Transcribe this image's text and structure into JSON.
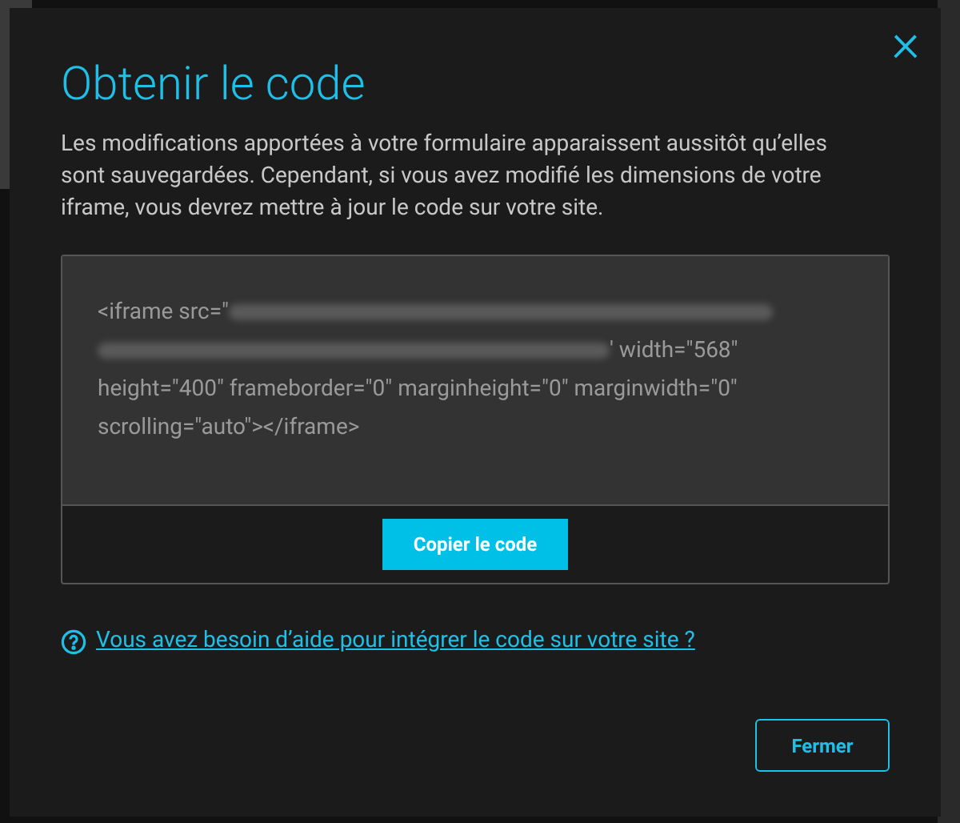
{
  "dialog": {
    "title": "Obtenir le code",
    "close": "×",
    "description": "Les modifications apportées à votre formulaire apparaissent aussitôt qu’elles sont sauvegardées. Cependant, si vous avez modifié les dimensions de votre iframe, vous devrez mettre à jour le code sur votre site.",
    "code_lines": [
      "<iframe src=\"",
      "' width=\"568\"",
      "height=\"400\" frameborder=\"0\" marginheight=\"0\" marginwidth=\"0\"",
      "scrolling=\"auto\"></iframe>"
    ],
    "copy_button": "Copier le code",
    "help_link": "Vous avez besoin d’aide pour intégrer le code sur votre site ?",
    "close_button": "Fermer"
  }
}
